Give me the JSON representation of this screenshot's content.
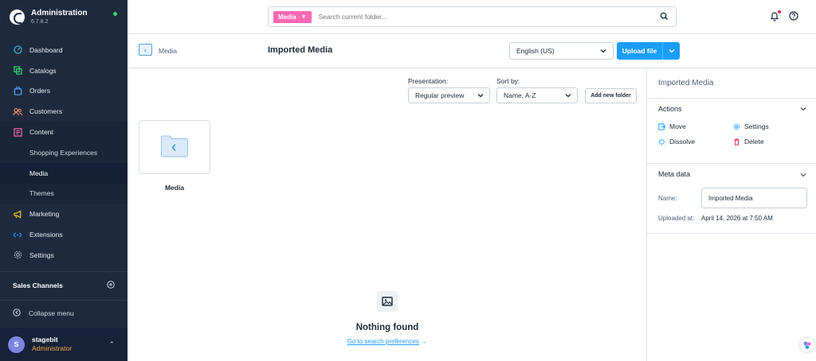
{
  "app": {
    "title": "Administration",
    "version": "6.7.8.2"
  },
  "sidebar": {
    "items": [
      {
        "label": "Dashboard",
        "icon": "gauge-icon"
      },
      {
        "label": "Catalogs",
        "icon": "catalog-icon"
      },
      {
        "label": "Orders",
        "icon": "shopping-bag-icon"
      },
      {
        "label": "Customers",
        "icon": "users-icon"
      },
      {
        "label": "Content",
        "icon": "content-icon"
      },
      {
        "label": "Shopping Experiences",
        "icon": ""
      },
      {
        "label": "Media",
        "icon": ""
      },
      {
        "label": "Themes",
        "icon": ""
      },
      {
        "label": "Marketing",
        "icon": "megaphone-icon"
      },
      {
        "label": "Extensions",
        "icon": "plug-icon"
      },
      {
        "label": "Settings",
        "icon": "gear-icon"
      }
    ],
    "sales_channels": "Sales Channels",
    "collapse": "Collapse menu",
    "user": {
      "initial": "S",
      "name": "stagebit",
      "role": "Administrator"
    }
  },
  "topbar": {
    "search_pill": "Media",
    "search_placeholder": "Search current folder..."
  },
  "header": {
    "breadcrumb": "Media",
    "title": "Imported Media",
    "language": "English (US)",
    "upload": "Upload file"
  },
  "toolbar": {
    "presentation_label": "Presentation:",
    "presentation_value": "Regular preview",
    "sort_label": "Sort by:",
    "sort_value": "Name, A-Z",
    "add_folder": "Add new folder"
  },
  "folders": [
    {
      "name": "Media"
    }
  ],
  "empty": {
    "title": "Nothing found",
    "link": "Go to search preferences",
    "arrow": "→"
  },
  "panel": {
    "title": "Imported Media",
    "actions_title": "Actions",
    "actions": {
      "move": "Move",
      "settings": "Settings",
      "dissolve": "Dissolve",
      "delete": "Delete"
    },
    "meta_title": "Meta data",
    "name_label": "Name:",
    "name_value": "Imported Media",
    "uploaded_label": "Uploaded at:",
    "uploaded_value": "April 14, 2026 at 7:50 AM"
  },
  "colors": {
    "sidebar_bg": "#1d2a3e",
    "primary": "#189eff",
    "media_pill": "#ff68b4",
    "role": "#f7a43a",
    "danger": "#de294c"
  }
}
